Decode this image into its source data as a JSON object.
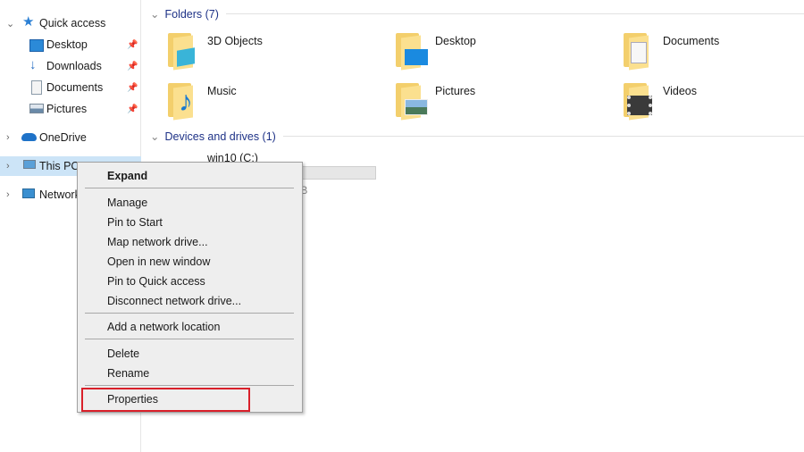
{
  "sidebar": {
    "quick_access": "Quick access",
    "items": [
      {
        "label": "Desktop",
        "icon": "desktop-icon",
        "pinned": true
      },
      {
        "label": "Downloads",
        "icon": "downloads-icon",
        "pinned": true
      },
      {
        "label": "Documents",
        "icon": "documents-icon",
        "pinned": true
      },
      {
        "label": "Pictures",
        "icon": "pictures-icon",
        "pinned": true
      }
    ],
    "onedrive": "OneDrive",
    "this_pc": "This PC",
    "network": "Network"
  },
  "main": {
    "folders_header": "Folders (7)",
    "folders": [
      "3D Objects",
      "Desktop",
      "Documents",
      "Music",
      "Pictures",
      "Videos"
    ],
    "devices_header": "Devices and drives (1)",
    "drive": {
      "name": "win10 (C:)",
      "size_text": "GB"
    }
  },
  "context_menu": {
    "items": [
      "Expand",
      "Manage",
      "Pin to Start",
      "Map network drive...",
      "Open in new window",
      "Pin to Quick access",
      "Disconnect network drive...",
      "Add a network location",
      "Delete",
      "Rename",
      "Properties"
    ],
    "highlight_color": "#d9202a"
  }
}
